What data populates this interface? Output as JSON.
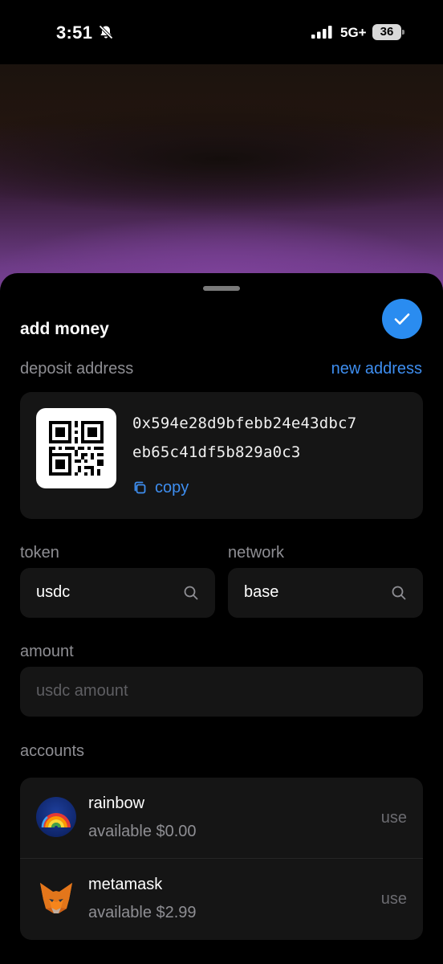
{
  "status_bar": {
    "time": "3:51",
    "network": "5G+",
    "battery": "36",
    "icons": [
      "bell-off-icon",
      "signal-icon",
      "battery-icon"
    ]
  },
  "sheet": {
    "title": "add money",
    "confirm_icon": "checkmark-icon",
    "accent_color": "#2a8cf0"
  },
  "deposit": {
    "label": "deposit address",
    "new_address_link": "new address",
    "address_line1": "0x594e28d9bfebb24e43dbc7",
    "address_line2": "eb65c41df5b829a0c3",
    "copy_label": "copy",
    "qr_icon": "qr-code"
  },
  "token": {
    "label": "token",
    "value": "usdc"
  },
  "network": {
    "label": "network",
    "value": "base"
  },
  "amount": {
    "label": "amount",
    "placeholder": "usdc amount"
  },
  "accounts": {
    "label": "accounts",
    "items": [
      {
        "name": "rainbow",
        "balance": "available $0.00",
        "action": "use",
        "icon": "rainbow-wallet-icon"
      },
      {
        "name": "metamask",
        "balance": "available $2.99",
        "action": "use",
        "icon": "metamask-fox-icon"
      }
    ]
  }
}
